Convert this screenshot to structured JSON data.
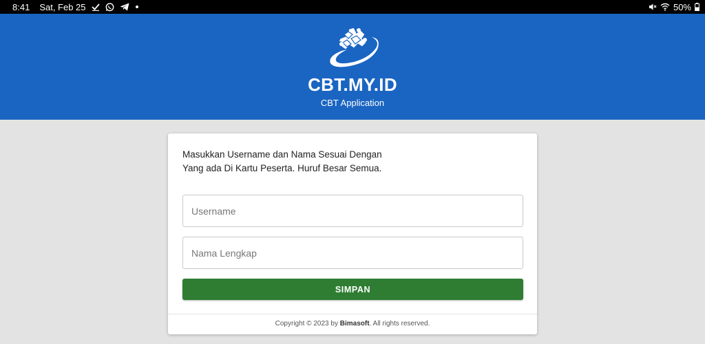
{
  "status_bar": {
    "time": "8:41",
    "date": "Sat, Feb 25",
    "notification_icons": [
      "check-icon",
      "whatsapp-icon",
      "telegram-icon",
      "dot-icon"
    ],
    "system_icons": [
      "mute-icon",
      "wifi-icon",
      "battery-icon"
    ],
    "battery": "50%"
  },
  "header": {
    "title": "CBT.MY.ID",
    "subtitle": "CBT Application",
    "background": "#1a65c2"
  },
  "login_card": {
    "instruction_line1": "Masukkan Username dan Nama Sesuai Dengan",
    "instruction_line2": "Yang ada Di Kartu Peserta. Huruf Besar Semua.",
    "username_placeholder": "Username",
    "username_value": "",
    "fullname_placeholder": "Nama Lengkap",
    "fullname_value": "",
    "save_label": "SIMPAN",
    "save_color": "#2e7d32"
  },
  "footer": {
    "prefix": "Copyright © 2023 by",
    "company": "Bimasoft",
    "suffix": ". All rights reserved."
  }
}
